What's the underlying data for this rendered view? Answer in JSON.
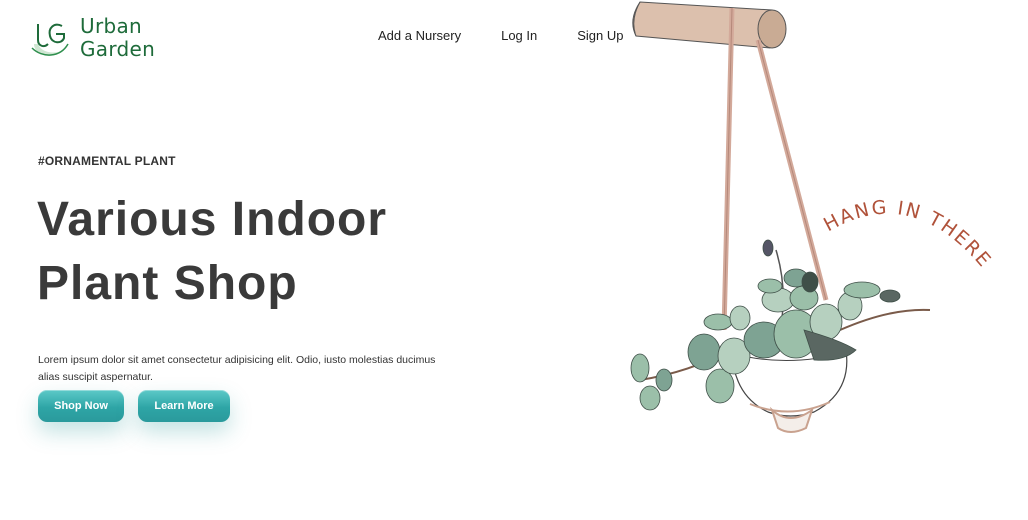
{
  "brand": {
    "line1": "Urban",
    "line2": "Garden",
    "logo_icon": "ug-monogram-leaf",
    "color": "#1e6b3a"
  },
  "nav": {
    "items": [
      {
        "label": "Add a Nursery"
      },
      {
        "label": "Log In"
      },
      {
        "label": "Sign Up"
      }
    ]
  },
  "hero": {
    "tag": "#ORNAMENTAL PLANT",
    "title_line1": "Various Indoor",
    "title_line2": "Plant Shop",
    "description": "Lorem ipsum dolor sit amet consectetur adipisicing elit. Odio, iusto molestias ducimus alias suscipit aspernatur.",
    "shop_label": "Shop Now",
    "learn_label": "Learn More",
    "accent": "#2ea5a6"
  },
  "illustration": {
    "caption": "HANG IN THERE",
    "caption_color": "#b0523a",
    "icon": "hanging-plant-illustration"
  }
}
